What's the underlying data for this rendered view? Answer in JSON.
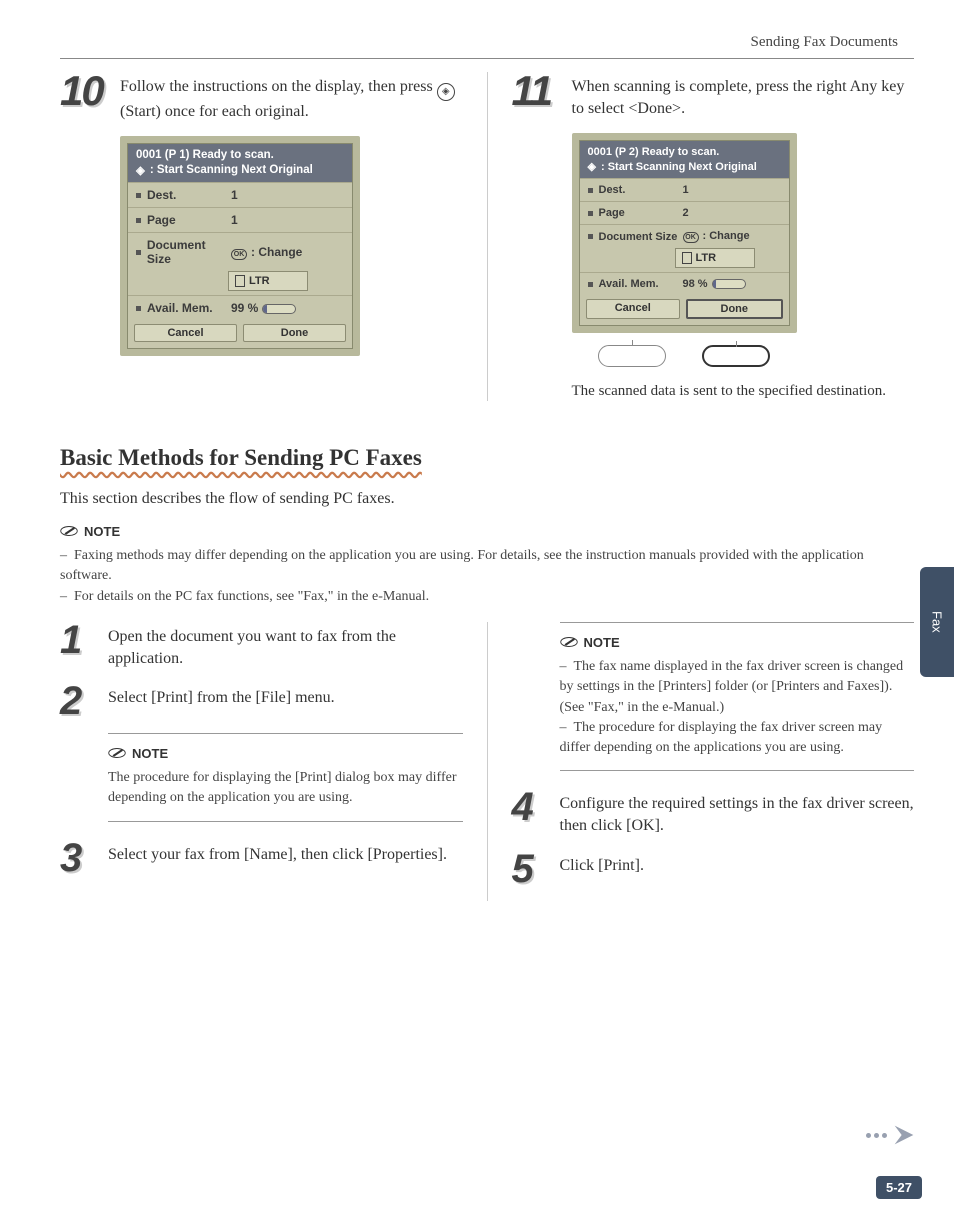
{
  "header": {
    "title": "Sending Fax Documents"
  },
  "step10": {
    "num": "10",
    "text_a": "Follow the instructions on the display, then press ",
    "text_b": " (Start) once for each original."
  },
  "step11": {
    "num": "11",
    "text": "When scanning is complete, press the right Any key to select <Done>.",
    "after": "The scanned data is sent to the specified destination."
  },
  "lcd10": {
    "head1": "0001 (P  1)  Ready to scan.",
    "head2": " : Start Scanning Next Original",
    "rows": {
      "dest": {
        "label": "Dest.",
        "val": "1"
      },
      "page": {
        "label": "Page",
        "val": "1"
      },
      "doc": {
        "label": "Document Size",
        "ok": "OK",
        "val": ": Change"
      },
      "sub": "LTR",
      "mem": {
        "label": "Avail. Mem.",
        "val": "99 %",
        "fill": 10
      }
    },
    "btns": {
      "cancel": "Cancel",
      "done": "Done"
    }
  },
  "lcd11": {
    "head1": "0001 (P  2)  Ready to scan.",
    "head2": " : Start Scanning Next Original",
    "rows": {
      "dest": {
        "label": "Dest.",
        "val": "1"
      },
      "page": {
        "label": "Page",
        "val": "2"
      },
      "doc": {
        "label": "Document Size",
        "ok": "OK",
        "val": ": Change"
      },
      "sub": "LTR",
      "mem": {
        "label": "Avail. Mem.",
        "val": "98 %",
        "fill": 12
      }
    },
    "btns": {
      "cancel": "Cancel",
      "done": "Done"
    }
  },
  "section": {
    "heading": "Basic Methods for Sending PC Faxes",
    "desc": "This section describes the flow of sending PC faxes."
  },
  "note_top": {
    "label": "NOTE",
    "items": [
      "Faxing methods may differ depending on the application you are using. For details, see the instruction manuals provided with the application software.",
      "For details on the PC fax functions, see \"Fax,\" in the e-Manual."
    ]
  },
  "steps": {
    "s1": {
      "num": "1",
      "text": "Open the document you want to fax from the application."
    },
    "s2": {
      "num": "2",
      "text": "Select [Print] from the [File] menu."
    },
    "s2note": {
      "label": "NOTE",
      "text": "The procedure for displaying the [Print] dialog box may differ depending on the application you are using."
    },
    "s3": {
      "num": "3",
      "text": "Select your fax from [Name], then click [Properties]."
    },
    "s3note": {
      "label": "NOTE",
      "items": [
        "The fax name displayed in the fax driver screen is changed by settings in the [Printers] folder (or [Printers and Faxes]). (See \"Fax,\" in the e-Manual.)",
        "The procedure for displaying the fax driver screen may differ depending on the applications you are using."
      ]
    },
    "s4": {
      "num": "4",
      "text": "Configure the required settings in the fax driver screen, then click [OK]."
    },
    "s5": {
      "num": "5",
      "text": "Click [Print]."
    }
  },
  "side_tab": "Fax",
  "page_num": "5-27"
}
